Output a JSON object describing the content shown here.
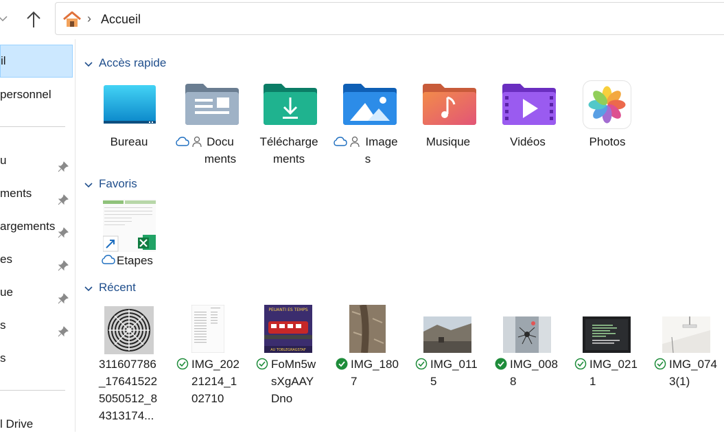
{
  "breadcrumb": {
    "location": "Accueil"
  },
  "sidebar": {
    "items": [
      {
        "label": "il"
      },
      {
        "label": " personnel"
      },
      {
        "label": "u"
      },
      {
        "label": "ments"
      },
      {
        "label": "argements"
      },
      {
        "label": "es"
      },
      {
        "label": "ue"
      },
      {
        "label": "s"
      },
      {
        "label": "s"
      },
      {
        "label": "l Drive"
      }
    ]
  },
  "sections": {
    "quick": {
      "title": "Accès rapide"
    },
    "favorites": {
      "title": "Favoris"
    },
    "recent": {
      "title": "Récent"
    }
  },
  "quick_access": [
    {
      "name": "Bureau",
      "icon": "desktop-folder-icon"
    },
    {
      "name": "Documents",
      "name_l1": "Docu",
      "name_l2": "ments",
      "icon": "documents-folder-icon"
    },
    {
      "name": "Téléchargements",
      "name_l1": "Télécharge",
      "name_l2": "ments",
      "icon": "downloads-folder-icon"
    },
    {
      "name": "Images",
      "name_l1": "Image",
      "name_l2": "s",
      "icon": "pictures-folder-icon"
    },
    {
      "name": "Musique",
      "icon": "music-folder-icon"
    },
    {
      "name": "Vidéos",
      "icon": "videos-folder-icon"
    },
    {
      "name": "Photos",
      "icon": "photos-app-icon"
    }
  ],
  "favorites": [
    {
      "name": "Etapes",
      "icon": "excel-shortcut-icon"
    }
  ],
  "recent": [
    {
      "l1": "311607786",
      "l2": "_17641522",
      "l3": "5050512_8",
      "l4": "4313174..."
    },
    {
      "l1": "IMG_202",
      "l2": "21214_1",
      "l3": "02710"
    },
    {
      "l1": "FoMn5w",
      "l2": "sXgAAY",
      "l3": "Dno"
    },
    {
      "l1": "IMG_180",
      "l2": "7"
    },
    {
      "l1": "IMG_011",
      "l2": "5"
    },
    {
      "l1": "IMG_008",
      "l2": "8"
    },
    {
      "l1": "IMG_021",
      "l2": "1"
    },
    {
      "l1": "IMG_074",
      "l2": "3(1)"
    }
  ],
  "recent_thumb_caption": {
    "title": "PEUANTI ES TEMPS",
    "sub": "AU TOBLEGRAGSTAF"
  },
  "colors": {
    "accent": "#1f4e8c",
    "selection": "#cce8ff",
    "synced_green": "#1e8c3a"
  }
}
